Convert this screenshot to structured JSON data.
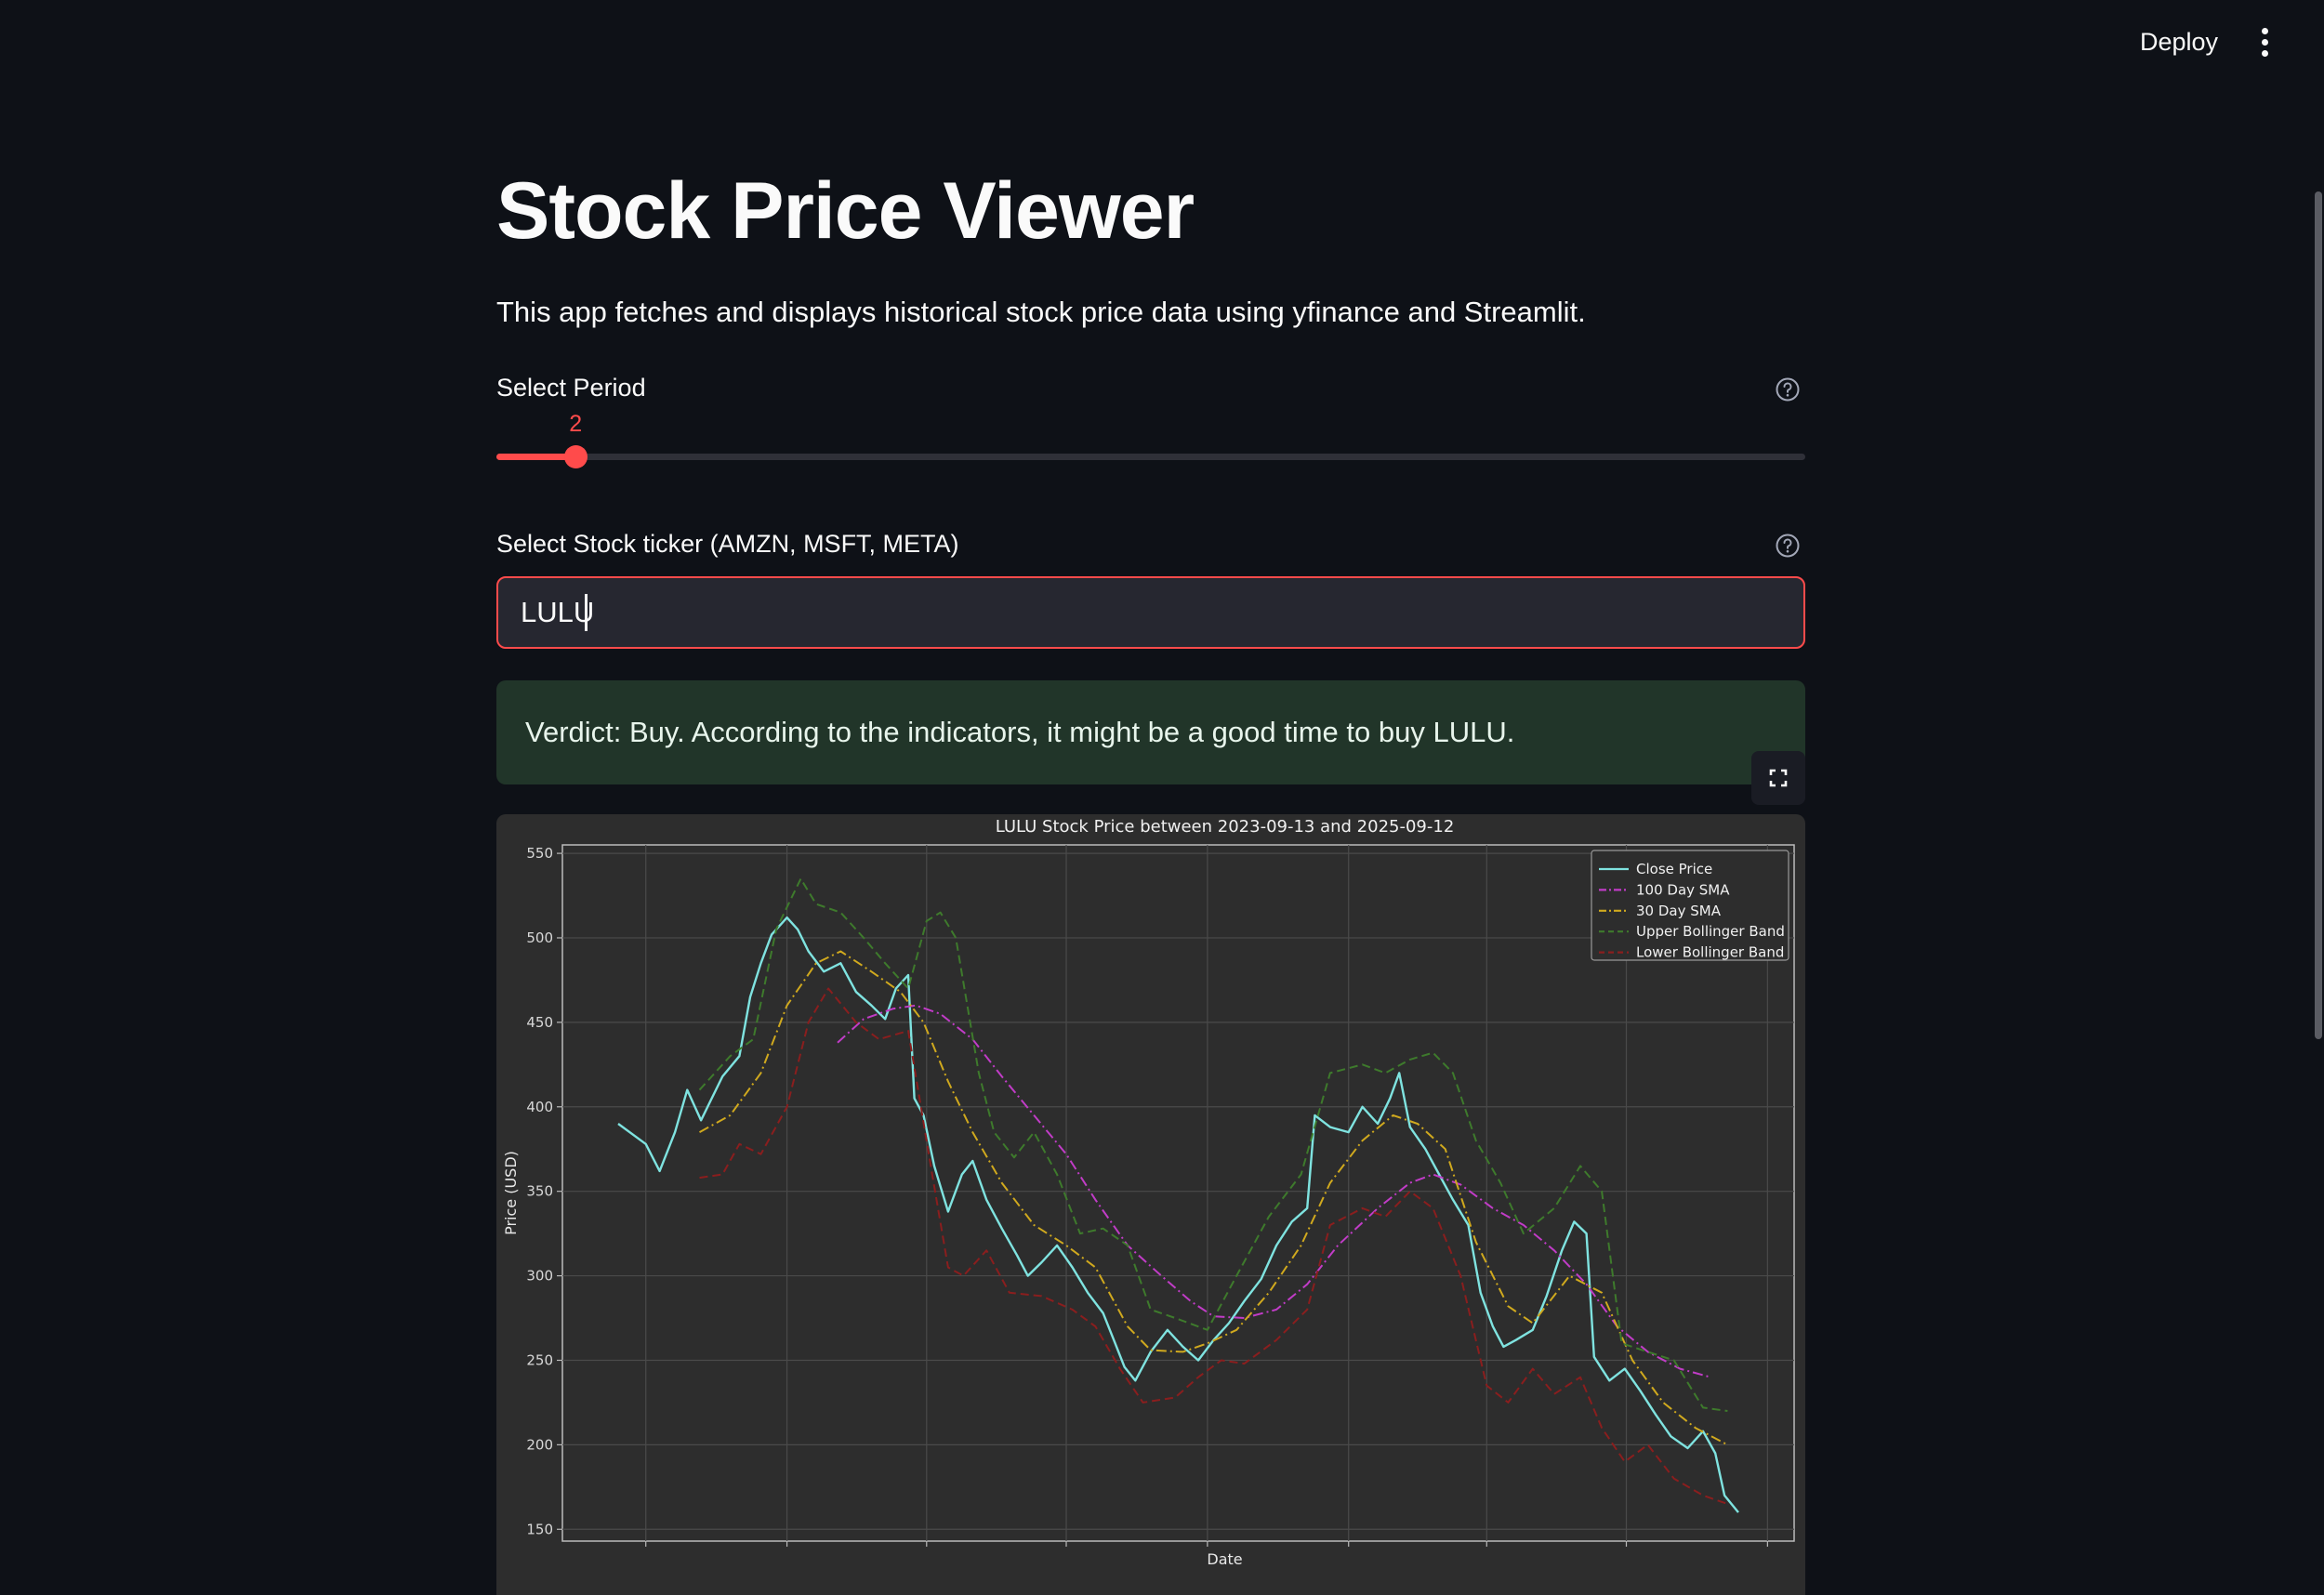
{
  "header": {
    "deploy_label": "Deploy"
  },
  "page": {
    "title": "Stock Price Viewer",
    "description": "This app fetches and displays historical stock price data using yfinance and Streamlit."
  },
  "period": {
    "label": "Select Period",
    "value": "2",
    "fraction": 0.052
  },
  "ticker": {
    "label": "Select Stock ticker (AMZN, MSFT, META)",
    "value": "LULU"
  },
  "verdict": {
    "text": "Verdict: Buy. According to the indicators, it might be a good time to buy LULU."
  },
  "colors": {
    "accent": "#ff4b4b",
    "background": "#0e1117",
    "success_bg": "#213529",
    "close": "#7fe3e0",
    "sma100": "#c13cc7",
    "sma30": "#d0a91e",
    "upper_band": "#3e7a2c",
    "lower_band": "#8a1e1e"
  },
  "icons": {
    "help": "question-circle-icon",
    "fullscreen": "fullscreen-icon",
    "menu": "kebab-menu-icon"
  },
  "chart_data": {
    "type": "line",
    "title": "LULU Stock Price between 2023-09-13 and 2025-09-12",
    "xlabel": "Date",
    "ylabel": "Price (USD)",
    "x_range": [
      "2023-09-13",
      "2025-09-12"
    ],
    "ylim": [
      143,
      555
    ],
    "yticks": [
      150,
      200,
      250,
      300,
      350,
      400,
      450,
      500,
      550
    ],
    "grid": true,
    "legend": "top-right",
    "series": [
      {
        "name": "Close Price",
        "style": "solid",
        "color": "#7fe3e0",
        "points": [
          [
            "2023-09-13",
            390
          ],
          [
            "2023-10-01",
            378
          ],
          [
            "2023-10-10",
            362
          ],
          [
            "2023-10-20",
            385
          ],
          [
            "2023-10-28",
            410
          ],
          [
            "2023-11-06",
            392
          ],
          [
            "2023-11-20",
            418
          ],
          [
            "2023-12-01",
            430
          ],
          [
            "2023-12-08",
            465
          ],
          [
            "2023-12-15",
            485
          ],
          [
            "2023-12-22",
            502
          ],
          [
            "2024-01-01",
            512
          ],
          [
            "2024-01-08",
            505
          ],
          [
            "2024-01-15",
            492
          ],
          [
            "2024-01-25",
            480
          ],
          [
            "2024-02-05",
            485
          ],
          [
            "2024-02-15",
            468
          ],
          [
            "2024-02-25",
            460
          ],
          [
            "2024-03-05",
            452
          ],
          [
            "2024-03-12",
            470
          ],
          [
            "2024-03-20",
            478
          ],
          [
            "2024-03-24",
            405
          ],
          [
            "2024-03-30",
            395
          ],
          [
            "2024-04-06",
            365
          ],
          [
            "2024-04-15",
            338
          ],
          [
            "2024-04-24",
            360
          ],
          [
            "2024-05-01",
            368
          ],
          [
            "2024-05-10",
            345
          ],
          [
            "2024-05-20",
            328
          ],
          [
            "2024-05-30",
            312
          ],
          [
            "2024-06-06",
            300
          ],
          [
            "2024-06-15",
            308
          ],
          [
            "2024-06-25",
            318
          ],
          [
            "2024-07-05",
            305
          ],
          [
            "2024-07-15",
            290
          ],
          [
            "2024-07-25",
            278
          ],
          [
            "2024-08-01",
            262
          ],
          [
            "2024-08-08",
            246
          ],
          [
            "2024-08-15",
            238
          ],
          [
            "2024-08-25",
            255
          ],
          [
            "2024-09-05",
            268
          ],
          [
            "2024-09-15",
            258
          ],
          [
            "2024-09-25",
            250
          ],
          [
            "2024-10-05",
            262
          ],
          [
            "2024-10-15",
            272
          ],
          [
            "2024-10-25",
            285
          ],
          [
            "2024-11-05",
            298
          ],
          [
            "2024-11-15",
            318
          ],
          [
            "2024-11-25",
            332
          ],
          [
            "2024-12-05",
            340
          ],
          [
            "2024-12-10",
            395
          ],
          [
            "2024-12-20",
            388
          ],
          [
            "2025-01-01",
            385
          ],
          [
            "2025-01-10",
            400
          ],
          [
            "2025-01-20",
            390
          ],
          [
            "2025-01-28",
            405
          ],
          [
            "2025-02-03",
            420
          ],
          [
            "2025-02-10",
            388
          ],
          [
            "2025-02-20",
            375
          ],
          [
            "2025-03-01",
            360
          ],
          [
            "2025-03-10",
            345
          ],
          [
            "2025-03-20",
            330
          ],
          [
            "2025-03-28",
            290
          ],
          [
            "2025-04-05",
            270
          ],
          [
            "2025-04-12",
            258
          ],
          [
            "2025-04-20",
            262
          ],
          [
            "2025-05-01",
            268
          ],
          [
            "2025-05-10",
            288
          ],
          [
            "2025-05-20",
            315
          ],
          [
            "2025-05-28",
            332
          ],
          [
            "2025-06-05",
            325
          ],
          [
            "2025-06-10",
            252
          ],
          [
            "2025-06-20",
            238
          ],
          [
            "2025-06-30",
            245
          ],
          [
            "2025-07-10",
            232
          ],
          [
            "2025-07-20",
            218
          ],
          [
            "2025-07-30",
            205
          ],
          [
            "2025-08-10",
            198
          ],
          [
            "2025-08-20",
            208
          ],
          [
            "2025-08-28",
            195
          ],
          [
            "2025-09-03",
            170
          ],
          [
            "2025-09-12",
            160
          ]
        ]
      },
      {
        "name": "100 Day SMA",
        "style": "dashdot",
        "color": "#c13cc7",
        "points": [
          [
            "2024-02-03",
            438
          ],
          [
            "2024-02-20",
            452
          ],
          [
            "2024-03-10",
            458
          ],
          [
            "2024-03-25",
            460
          ],
          [
            "2024-04-10",
            455
          ],
          [
            "2024-05-01",
            440
          ],
          [
            "2024-05-20",
            418
          ],
          [
            "2024-06-10",
            395
          ],
          [
            "2024-07-01",
            372
          ],
          [
            "2024-07-20",
            345
          ],
          [
            "2024-08-10",
            318
          ],
          [
            "2024-09-01",
            300
          ],
          [
            "2024-09-20",
            285
          ],
          [
            "2024-10-05",
            276
          ],
          [
            "2024-10-25",
            275
          ],
          [
            "2024-11-15",
            280
          ],
          [
            "2024-12-05",
            295
          ],
          [
            "2024-12-25",
            318
          ],
          [
            "2025-01-20",
            340
          ],
          [
            "2025-02-10",
            355
          ],
          [
            "2025-02-25",
            360
          ],
          [
            "2025-03-15",
            354
          ],
          [
            "2025-04-05",
            340
          ],
          [
            "2025-04-25",
            330
          ],
          [
            "2025-05-15",
            315
          ],
          [
            "2025-06-05",
            295
          ],
          [
            "2025-06-25",
            270
          ],
          [
            "2025-07-15",
            255
          ],
          [
            "2025-08-05",
            245
          ],
          [
            "2025-08-25",
            240
          ]
        ]
      },
      {
        "name": "30 Day SMA",
        "style": "dashdot",
        "color": "#d0a91e",
        "points": [
          [
            "2023-11-05",
            385
          ],
          [
            "2023-11-25",
            395
          ],
          [
            "2023-12-15",
            420
          ],
          [
            "2024-01-01",
            460
          ],
          [
            "2024-01-20",
            485
          ],
          [
            "2024-02-05",
            492
          ],
          [
            "2024-02-25",
            480
          ],
          [
            "2024-03-15",
            468
          ],
          [
            "2024-03-30",
            450
          ],
          [
            "2024-04-15",
            415
          ],
          [
            "2024-05-01",
            385
          ],
          [
            "2024-05-20",
            355
          ],
          [
            "2024-06-10",
            330
          ],
          [
            "2024-07-01",
            318
          ],
          [
            "2024-07-20",
            305
          ],
          [
            "2024-08-10",
            270
          ],
          [
            "2024-08-25",
            256
          ],
          [
            "2024-09-15",
            255
          ],
          [
            "2024-10-01",
            260
          ],
          [
            "2024-10-20",
            268
          ],
          [
            "2024-11-10",
            290
          ],
          [
            "2024-12-01",
            318
          ],
          [
            "2024-12-20",
            355
          ],
          [
            "2025-01-10",
            380
          ],
          [
            "2025-01-30",
            395
          ],
          [
            "2025-02-15",
            390
          ],
          [
            "2025-03-05",
            375
          ],
          [
            "2025-03-25",
            320
          ],
          [
            "2025-04-15",
            282
          ],
          [
            "2025-05-01",
            272
          ],
          [
            "2025-05-25",
            300
          ],
          [
            "2025-06-15",
            290
          ],
          [
            "2025-07-05",
            250
          ],
          [
            "2025-07-25",
            225
          ],
          [
            "2025-08-15",
            210
          ],
          [
            "2025-09-05",
            200
          ]
        ]
      },
      {
        "name": "Upper Bollinger Band",
        "style": "dashed",
        "color": "#3e7a2c",
        "points": [
          [
            "2023-11-05",
            410
          ],
          [
            "2023-11-25",
            430
          ],
          [
            "2023-12-10",
            440
          ],
          [
            "2023-12-25",
            505
          ],
          [
            "2024-01-10",
            535
          ],
          [
            "2024-01-20",
            520
          ],
          [
            "2024-02-05",
            515
          ],
          [
            "2024-02-20",
            500
          ],
          [
            "2024-03-05",
            485
          ],
          [
            "2024-03-20",
            470
          ],
          [
            "2024-04-01",
            510
          ],
          [
            "2024-04-10",
            515
          ],
          [
            "2024-04-20",
            500
          ],
          [
            "2024-05-05",
            420
          ],
          [
            "2024-05-15",
            385
          ],
          [
            "2024-05-28",
            370
          ],
          [
            "2024-06-10",
            385
          ],
          [
            "2024-06-25",
            360
          ],
          [
            "2024-07-10",
            325
          ],
          [
            "2024-07-25",
            328
          ],
          [
            "2024-08-10",
            318
          ],
          [
            "2024-08-25",
            280
          ],
          [
            "2024-09-10",
            275
          ],
          [
            "2024-10-01",
            268
          ],
          [
            "2024-10-20",
            300
          ],
          [
            "2024-11-10",
            335
          ],
          [
            "2024-12-01",
            360
          ],
          [
            "2024-12-20",
            420
          ],
          [
            "2025-01-10",
            425
          ],
          [
            "2025-01-25",
            420
          ],
          [
            "2025-02-10",
            428
          ],
          [
            "2025-02-25",
            432
          ],
          [
            "2025-03-10",
            420
          ],
          [
            "2025-03-25",
            380
          ],
          [
            "2025-04-10",
            355
          ],
          [
            "2025-04-25",
            325
          ],
          [
            "2025-05-15",
            340
          ],
          [
            "2025-06-01",
            365
          ],
          [
            "2025-06-15",
            350
          ],
          [
            "2025-06-28",
            260
          ],
          [
            "2025-07-15",
            255
          ],
          [
            "2025-08-01",
            250
          ],
          [
            "2025-08-20",
            222
          ],
          [
            "2025-09-05",
            220
          ]
        ]
      },
      {
        "name": "Lower Bollinger Band",
        "style": "dashed",
        "color": "#8a1e1e",
        "points": [
          [
            "2023-11-05",
            358
          ],
          [
            "2023-11-20",
            360
          ],
          [
            "2023-12-01",
            378
          ],
          [
            "2023-12-15",
            372
          ],
          [
            "2024-01-01",
            400
          ],
          [
            "2024-01-15",
            450
          ],
          [
            "2024-01-28",
            470
          ],
          [
            "2024-02-15",
            450
          ],
          [
            "2024-03-01",
            440
          ],
          [
            "2024-03-20",
            445
          ],
          [
            "2024-04-05",
            358
          ],
          [
            "2024-04-15",
            305
          ],
          [
            "2024-04-25",
            300
          ],
          [
            "2024-05-10",
            315
          ],
          [
            "2024-05-25",
            290
          ],
          [
            "2024-06-15",
            288
          ],
          [
            "2024-07-05",
            280
          ],
          [
            "2024-07-20",
            270
          ],
          [
            "2024-08-05",
            245
          ],
          [
            "2024-08-20",
            225
          ],
          [
            "2024-09-10",
            228
          ],
          [
            "2024-09-25",
            240
          ],
          [
            "2024-10-10",
            250
          ],
          [
            "2024-10-25",
            248
          ],
          [
            "2024-11-15",
            262
          ],
          [
            "2024-12-05",
            280
          ],
          [
            "2024-12-20",
            330
          ],
          [
            "2025-01-10",
            340
          ],
          [
            "2025-01-25",
            335
          ],
          [
            "2025-02-10",
            350
          ],
          [
            "2025-02-25",
            340
          ],
          [
            "2025-03-15",
            300
          ],
          [
            "2025-04-01",
            235
          ],
          [
            "2025-04-15",
            225
          ],
          [
            "2025-05-01",
            245
          ],
          [
            "2025-05-15",
            230
          ],
          [
            "2025-06-01",
            240
          ],
          [
            "2025-06-15",
            210
          ],
          [
            "2025-06-30",
            190
          ],
          [
            "2025-07-15",
            200
          ],
          [
            "2025-08-01",
            180
          ],
          [
            "2025-08-20",
            170
          ],
          [
            "2025-09-05",
            165
          ]
        ]
      }
    ]
  }
}
